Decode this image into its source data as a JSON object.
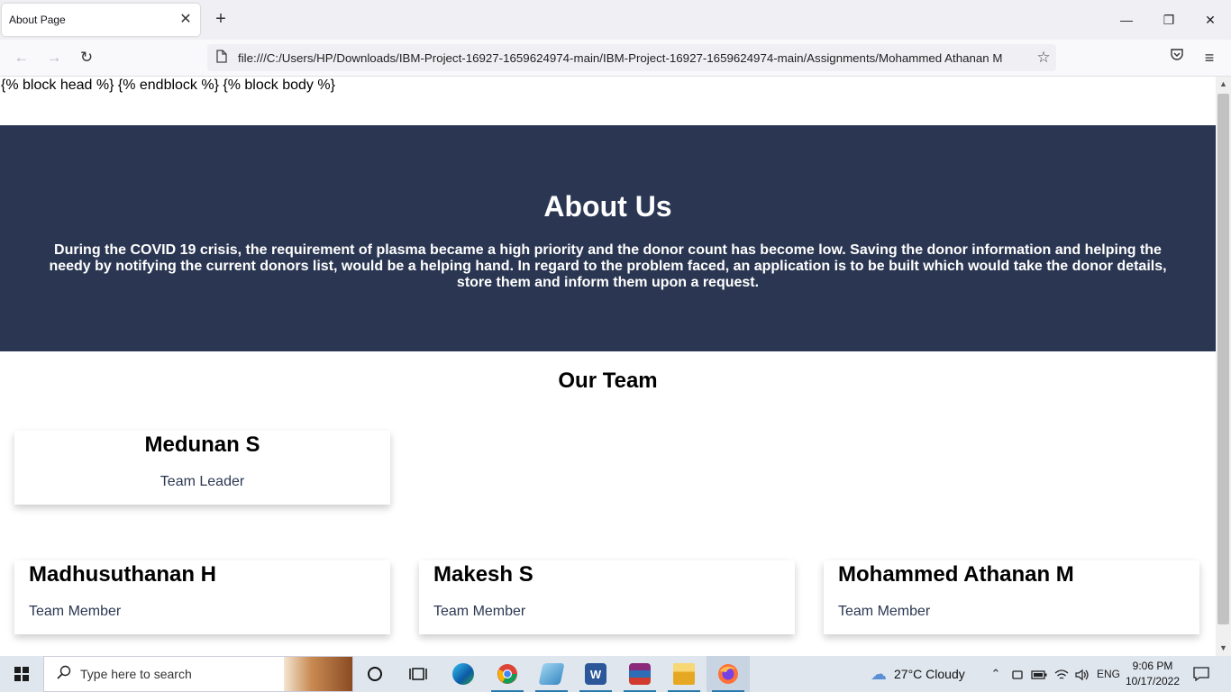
{
  "browser": {
    "tab_title": "About Page",
    "tab_close": "✕",
    "new_tab": "+",
    "window_controls": {
      "minimize": "—",
      "restore": "❐",
      "close": "✕"
    },
    "url": "file:///C:/Users/HP/Downloads/IBM-Project-16927-1659624974-main/IBM-Project-16927-1659624974-main/Assignments/Mohammed Athanan M",
    "nav": {
      "back": "←",
      "forward": "→",
      "reload": "↻",
      "star": "☆",
      "pocket": "◡",
      "menu": "≡"
    }
  },
  "page": {
    "template_text": "{% block head %} {% endblock %} {% block body %}",
    "about_title": "About Us",
    "about_text": "During the COVID 19 crisis, the requirement of plasma became a high priority and the donor count has become low. Saving the donor information and helping the needy by notifying the current donors list, would be a helping hand. In regard to the problem faced, an application is to be built which would take the donor details, store them and inform them upon a request.",
    "team_title": "Our Team",
    "leader": {
      "name": "Medunan S",
      "role": "Team Leader"
    },
    "members": [
      {
        "name": "Madhusuthanan H",
        "role": "Team Member"
      },
      {
        "name": "Makesh S",
        "role": "Team Member"
      },
      {
        "name": "Mohammed Athanan M",
        "role": "Team Member"
      }
    ],
    "colors": {
      "hero_bg": "#2b3752",
      "role_text": "#2b3752"
    }
  },
  "taskbar": {
    "search_placeholder": "Type here to search",
    "weather": "27°C  Cloudy",
    "language": "ENG",
    "time": "9:06 PM",
    "date": "10/17/2022",
    "apps": [
      "cortana-icon",
      "task-view-icon",
      "edge-icon",
      "chrome-icon",
      "app-icon",
      "word-icon",
      "winrar-icon",
      "file-explorer-icon",
      "firefox-icon"
    ]
  }
}
